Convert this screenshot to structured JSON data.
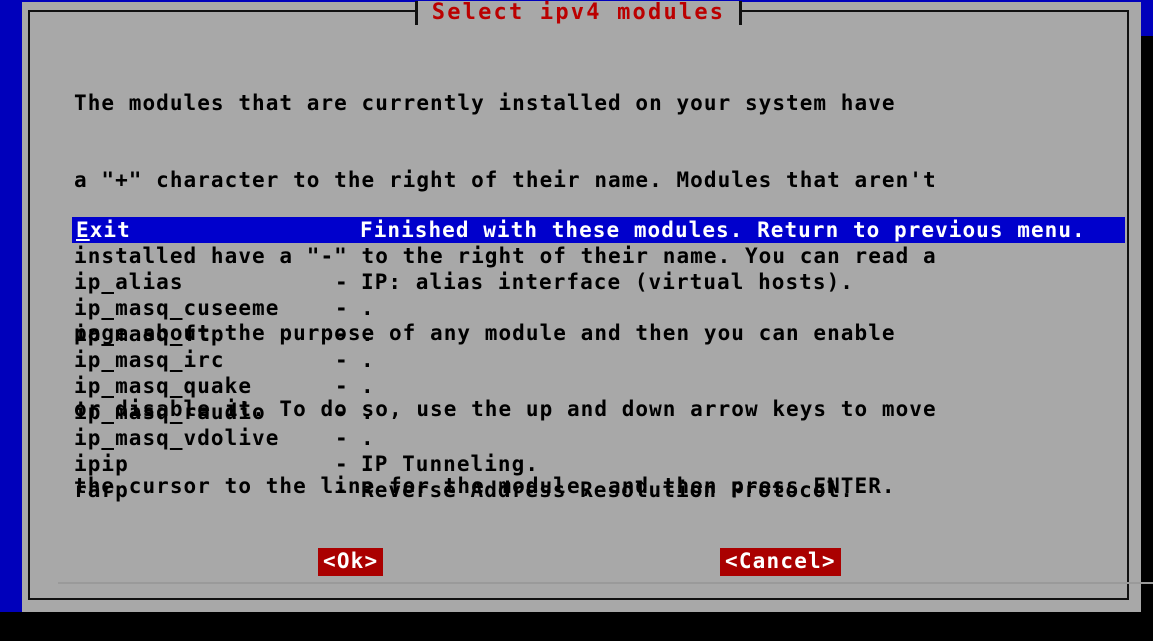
{
  "window": {
    "title": "Select ipv4 modules",
    "backdrop_color": "#0000bb",
    "dialog_bg": "#a8a8a8",
    "title_color": "#bb0000"
  },
  "description": [
    "The modules that are currently installed on your system have",
    "a \"+\" character to the right of their name. Modules that aren't",
    "installed have a \"-\" to the right of their name. You can read a",
    "page about the purpose of any module and then you can enable",
    "or disable it. To do so, use the up and down arrow keys to move",
    "the cursor to the line for the module, and then press ENTER."
  ],
  "selected_row": {
    "label": "Exit",
    "mnemonic": "E",
    "label_rest": "xit",
    "description": "Finished with these modules. Return to previous menu.",
    "highlight_color": "#0000cc",
    "text_color": "#ffffff"
  },
  "modules": [
    {
      "name": "ip_alias",
      "flag": "-",
      "description": "IP: alias interface (virtual hosts)."
    },
    {
      "name": "ip_masq_cuseeme",
      "flag": "-",
      "description": "."
    },
    {
      "name": "ip_masq_ftp",
      "flag": "-",
      "description": "."
    },
    {
      "name": "ip_masq_irc",
      "flag": "-",
      "description": "."
    },
    {
      "name": "ip_masq_quake",
      "flag": "-",
      "description": "."
    },
    {
      "name": "ip_masq_raudio",
      "flag": "-",
      "description": "."
    },
    {
      "name": "ip_masq_vdolive",
      "flag": "-",
      "description": "."
    },
    {
      "name": "ipip",
      "flag": "-",
      "description": "IP Tunneling."
    },
    {
      "name": "rarp",
      "flag": "-",
      "description": "Reverse Address Resolution Protocol."
    }
  ],
  "buttons": {
    "ok": "<Ok>",
    "cancel": "<Cancel>",
    "bg_color": "#aa0000",
    "fg_color": "#ffffff"
  }
}
